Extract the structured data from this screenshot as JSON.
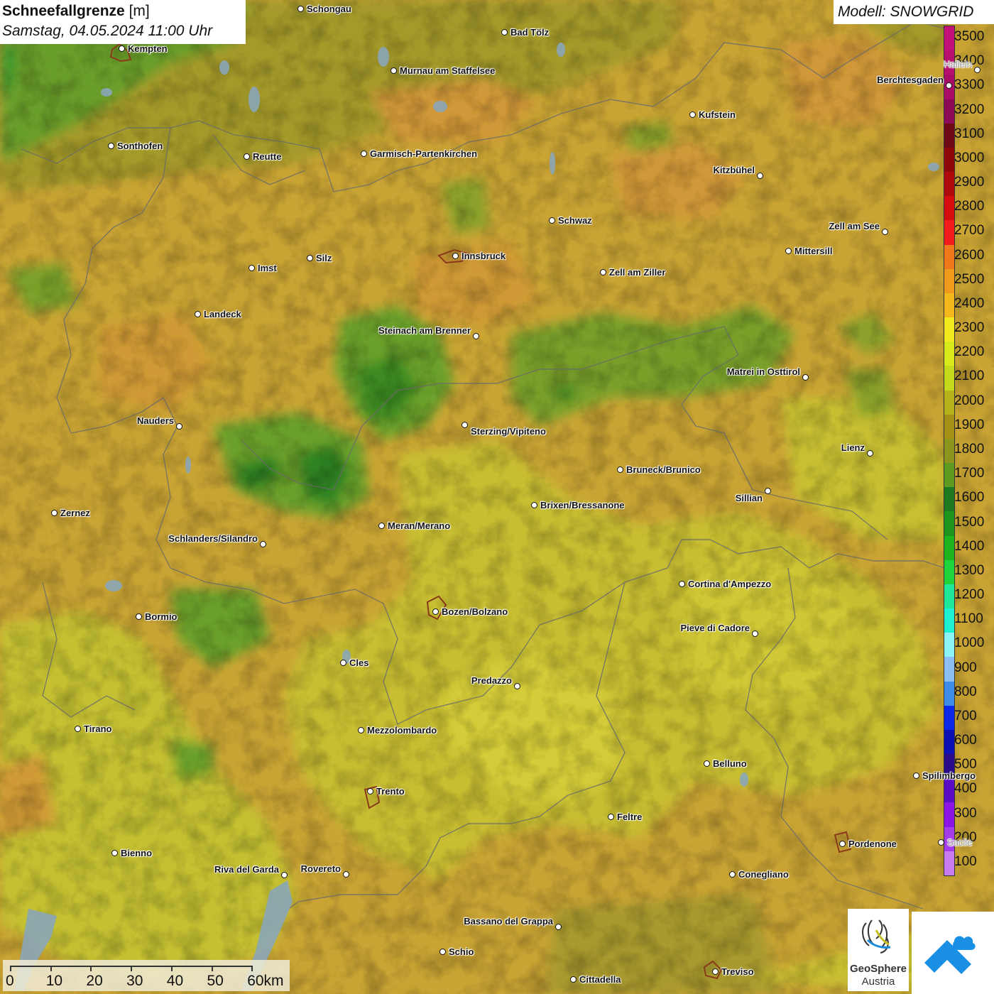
{
  "title": {
    "parameter": "Schneefallgrenze",
    "unit": "[m]",
    "datetime": "Samstag, 04.05.2024 11:00 Uhr"
  },
  "model_label": "Modell: SNOWGRID",
  "legend": {
    "labels": [
      "3500",
      "3400",
      "3300",
      "3200",
      "3100",
      "3000",
      "2900",
      "2800",
      "2700",
      "2600",
      "2500",
      "2400",
      "2300",
      "2200",
      "2100",
      "2000",
      "1900",
      "1800",
      "1700",
      "1600",
      "1500",
      "1400",
      "1300",
      "1200",
      "1100",
      "1000",
      "900",
      "800",
      "700",
      "600",
      "500",
      "400",
      "300",
      "200",
      "100"
    ],
    "colors": [
      "#c2127a",
      "#b60f6f",
      "#a80c66",
      "#8c0a55",
      "#6e0812",
      "#8e0808",
      "#ae0a0a",
      "#d40c0c",
      "#f21c1c",
      "#f2781c",
      "#f29a1c",
      "#f2b81c",
      "#f2ea1c",
      "#d8ea1c",
      "#c4d81c",
      "#b4b41a",
      "#a49012",
      "#8c961c",
      "#5e9a20",
      "#1e7a1e",
      "#1e961e",
      "#1eb41e",
      "#1ed43a",
      "#1ee89a",
      "#1ef0d2",
      "#8cf4f4",
      "#8cc0f0",
      "#3c8ce8",
      "#0c28e8",
      "#0c10b4",
      "#2a0c8a",
      "#5a0cc4",
      "#8c14e4",
      "#a43ce8",
      "#c87af0"
    ]
  },
  "cities": [
    {
      "name": "Schongau"
    },
    {
      "name": "Bad Tölz"
    },
    {
      "name": "Kempten"
    },
    {
      "name": "Murnau am Staffelsee"
    },
    {
      "name": "Kufstein"
    },
    {
      "name": "Berchtesgaden"
    },
    {
      "name": "Sonthofen"
    },
    {
      "name": "Reutte"
    },
    {
      "name": "Garmisch-Partenkirchen"
    },
    {
      "name": "Kitzbühel"
    },
    {
      "name": "Schwaz"
    },
    {
      "name": "Zell am See"
    },
    {
      "name": "Innsbruck"
    },
    {
      "name": "Mittersill"
    },
    {
      "name": "Imst"
    },
    {
      "name": "Silz"
    },
    {
      "name": "Zell am Ziller"
    },
    {
      "name": "Landeck"
    },
    {
      "name": "Steinach am Brenner"
    },
    {
      "name": "Matrei in Osttirol"
    },
    {
      "name": "Nauders"
    },
    {
      "name": "Sterzing/Vipiteno"
    },
    {
      "name": "Lienz"
    },
    {
      "name": "Bruneck/Brunico"
    },
    {
      "name": "Sillian"
    },
    {
      "name": "Zernez"
    },
    {
      "name": "Brixen/Bressanone"
    },
    {
      "name": "Meran/Merano"
    },
    {
      "name": "Schlanders/Silandro"
    },
    {
      "name": "Cortina d'Ampezzo"
    },
    {
      "name": "Bozen/Bolzano"
    },
    {
      "name": "Bormio"
    },
    {
      "name": "Pieve di Cadore"
    },
    {
      "name": "Cles"
    },
    {
      "name": "Predazzo"
    },
    {
      "name": "Tirano"
    },
    {
      "name": "Mezzolombardo"
    },
    {
      "name": "Belluno"
    },
    {
      "name": "Spilimbergo"
    },
    {
      "name": "Trento"
    },
    {
      "name": "Feltre"
    },
    {
      "name": "Pordenone"
    },
    {
      "name": "Bienno"
    },
    {
      "name": "Riva del Garda"
    },
    {
      "name": "Rovereto"
    },
    {
      "name": "Conegliano"
    },
    {
      "name": "Bassano del Grappa"
    },
    {
      "name": "Schio"
    },
    {
      "name": "Treviso"
    },
    {
      "name": "Cittadella"
    },
    {
      "name": "Hallein"
    },
    {
      "name": "Sacile"
    }
  ],
  "scale_bar": {
    "labels": [
      "0",
      "10",
      "20",
      "30",
      "40",
      "50",
      "60km"
    ]
  },
  "logo": {
    "line1": "GeoSphere",
    "line2": "Austria"
  },
  "colors": {
    "background": "#c9a434",
    "title_box": "#ffffff"
  }
}
